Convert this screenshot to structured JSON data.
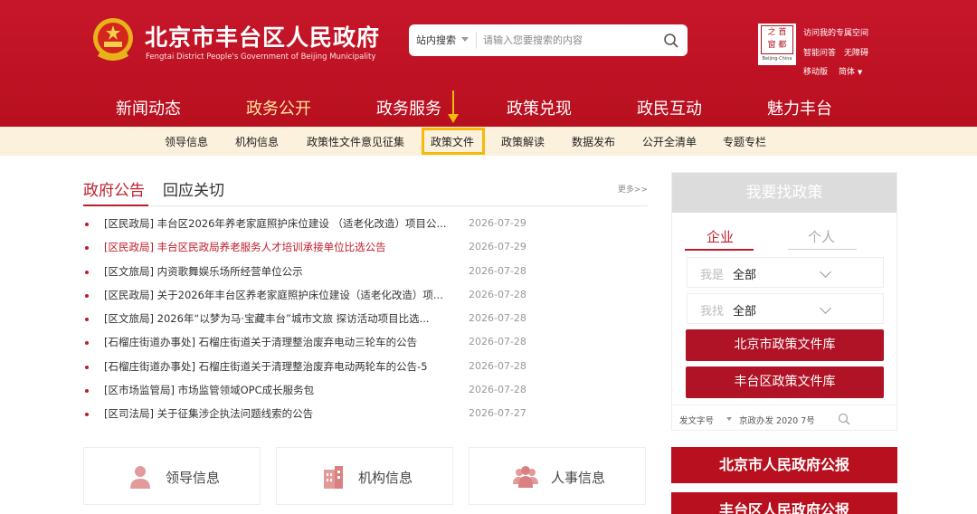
{
  "header": {
    "title": "北京市丰台区人民政府",
    "subtitle": "Fengtai District People's Government of Beijing Municipality",
    "search": {
      "scope": "站内搜索",
      "placeholder": "请输入您要搜索的内容"
    },
    "beijing_logo": {
      "caption": "Beijing·China"
    },
    "tools": {
      "visit_space": "访问我的专属空间",
      "smart_qa": "智能问答",
      "accessibility": "无障碍",
      "mobile": "移动版",
      "language": "简体"
    }
  },
  "main_nav": {
    "items": [
      "新闻动态",
      "政务公开",
      "政务服务",
      "政策兑现",
      "政民互动",
      "魅力丰台"
    ],
    "active_index": 1
  },
  "sub_nav": {
    "items": [
      "领导信息",
      "机构信息",
      "政策性文件意见征集",
      "政策文件",
      "政策解读",
      "数据发布",
      "公开全清单",
      "专题专栏"
    ],
    "highlighted_index": 3
  },
  "notices": {
    "tabs": [
      "政府公告",
      "回应关切"
    ],
    "more": "更多>>",
    "items": [
      {
        "title": "[区民政局] 丰台区2026年养老家庭照护床位建设 （适老化改造）项目公...",
        "date": "2026-07-29",
        "highlight": false
      },
      {
        "title": "[区民政局] 丰台区民政局养老服务人才培训承接单位比选公告",
        "date": "2026-07-29",
        "highlight": true
      },
      {
        "title": "[区文旅局] 内资歌舞娱乐场所经营单位公示",
        "date": "2026-07-28",
        "highlight": false
      },
      {
        "title": "[区民政局] 关于2026年丰台区养老家庭照护床位建设（适老化改造）项...",
        "date": "2026-07-28",
        "highlight": false
      },
      {
        "title": "[区文旅局] 2026年“以梦为马·宝藏丰台”城市文旅 探访活动项目比选...",
        "date": "2026-07-28",
        "highlight": false
      },
      {
        "title": "[石榴庄街道办事处] 石榴庄街道关于清理整治废弃电动三轮车的公告",
        "date": "2026-07-28",
        "highlight": false
      },
      {
        "title": "[石榴庄街道办事处] 石榴庄街道关于清理整治废弃电动两轮车的公告-5",
        "date": "2026-07-28",
        "highlight": false
      },
      {
        "title": "[区市场监管局] 市场监管领域OPC成长服务包",
        "date": "2026-07-28",
        "highlight": false
      },
      {
        "title": "[区司法局] 关于征集涉企执法问题线索的公告",
        "date": "2026-07-27",
        "highlight": false
      }
    ]
  },
  "cards": [
    {
      "label": "领导信息",
      "icon": "person-icon"
    },
    {
      "label": "机构信息",
      "icon": "building-icon"
    },
    {
      "label": "人事信息",
      "icon": "people-icon"
    }
  ],
  "policy_panel": {
    "title": "我要找政策",
    "tabs": [
      "企业",
      "个人"
    ],
    "select_identity": {
      "label": "我是",
      "value": "全部"
    },
    "select_need": {
      "label": "我找",
      "value": "全部"
    },
    "buttons": [
      "北京市政策文件库",
      "丰台区政策文件库"
    ],
    "doc_number": {
      "label": "发文字号",
      "value": "京政办发 2020 7号"
    }
  },
  "gazette": [
    "北京市人民政府公报",
    "丰台区人民政府公报"
  ],
  "colors": {
    "brand_red": "#c01d2c",
    "highlight_yellow": "#f5b90b",
    "subnav_bg": "#fbf1dc"
  }
}
